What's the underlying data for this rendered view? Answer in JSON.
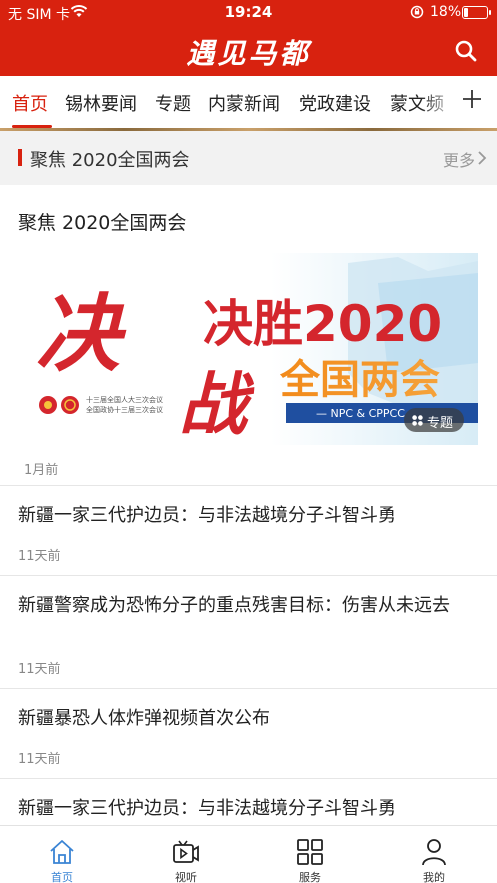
{
  "status_bar": {
    "carrier": "无 SIM 卡",
    "time": "19:24",
    "battery_percent": "18%",
    "battery_level": 0.18
  },
  "header": {
    "title": "遇见马都"
  },
  "tabs": [
    "首页",
    "锡林要闻",
    "专题",
    "内蒙新闻",
    "党政建设",
    "蒙文频"
  ],
  "active_tab": "首页",
  "section": {
    "title": "聚焦 2020全国两会",
    "more": "更多"
  },
  "feature": {
    "headline": "聚焦 2020全国两会",
    "banner": {
      "big_left": "决",
      "big_left2": "战",
      "main": "决胜2020",
      "sub": "全国两会",
      "small_line1": "十三届全国人大三次会议",
      "small_line2": "全国政协十三届三次会议",
      "tagline": "— NPC & CPPCC"
    },
    "tag": "专题",
    "time": "1月前"
  },
  "news": [
    {
      "title": "新疆一家三代护边员：与非法越境分子斗智斗勇",
      "time": "11天前"
    },
    {
      "title": "新疆警察成为恐怖分子的重点残害目标：伤害从未远去",
      "time": "11天前"
    },
    {
      "title": " 新疆暴恐人体炸弹视频首次公布",
      "time": "11天前"
    },
    {
      "title": "新疆一家三代护边员：与非法越境分子斗智斗勇",
      "time": ""
    }
  ],
  "bottom_nav": [
    {
      "label": "首页",
      "icon": "home-icon"
    },
    {
      "label": "视听",
      "icon": "video-icon"
    },
    {
      "label": "服务",
      "icon": "grid-icon"
    },
    {
      "label": "我的",
      "icon": "user-icon"
    }
  ],
  "colors": {
    "brand_red": "#d8220f",
    "active_blue": "#3a84d4",
    "text": "#222222",
    "muted": "#888888"
  }
}
